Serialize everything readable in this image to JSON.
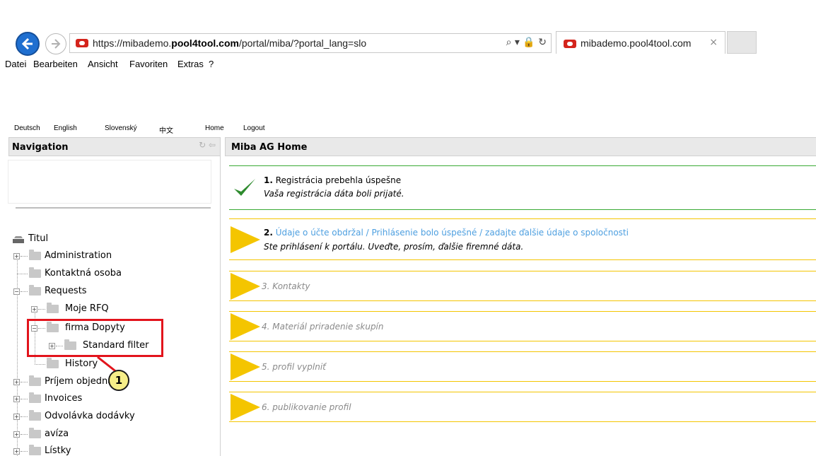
{
  "browser": {
    "url_prefix": "https://mibademo.",
    "url_domain": "pool4tool.com",
    "url_suffix": "/portal/miba/?portal_lang=slo",
    "address_tools": "⌕ ▾ 🔒 ↻",
    "tab_title": "mibademo.pool4tool.com",
    "tab_close": "×",
    "menu": [
      "Datei",
      "Bearbeiten",
      "Ansicht",
      "Favoriten",
      "Extras",
      "?"
    ]
  },
  "top_links": [
    "Deutsch",
    "English",
    "Slovenský",
    "中文",
    "Home",
    "Logout"
  ],
  "nav": {
    "title": "Navigation",
    "header_icons": "↻ ⇦",
    "root_label": "Titul",
    "nodes": [
      {
        "label": "Administration",
        "expander": "+"
      },
      {
        "label": "Kontaktná osoba",
        "expander": ""
      },
      {
        "label": "Requests",
        "expander": "−"
      },
      {
        "label": "Moje RFQ",
        "expander": "+"
      },
      {
        "label": "firma Dopyty",
        "expander": "−"
      },
      {
        "label": "Standard filter",
        "expander": "+"
      },
      {
        "label": "History",
        "expander": ""
      },
      {
        "label": "Príjem objednávky",
        "expander": "+"
      },
      {
        "label": "Invoices",
        "expander": "+"
      },
      {
        "label": "Odvolávka dodávky",
        "expander": "+"
      },
      {
        "label": "avíza",
        "expander": "+"
      },
      {
        "label": "Lístky",
        "expander": "+"
      }
    ]
  },
  "callout": {
    "number": "1"
  },
  "main": {
    "title": "Miba AG Home",
    "steps": [
      {
        "num": "1.",
        "title": "Registrácia prebehla úspešne",
        "subtitle": "Vaša registrácia dáta boli prijaté."
      },
      {
        "num": "2.",
        "title": "Údaje o účte obdržal / Prihlásenie bolo úspešné / zadajte ďalšie údaje o spoločnosti",
        "subtitle": "Ste prihlásení k portálu. Uveďte, prosím, ďalšie firemné dáta."
      },
      {
        "title": "3. Kontakty"
      },
      {
        "title": "4. Materiál priradenie skupín"
      },
      {
        "title": "5. profil vyplniť"
      },
      {
        "title": "6. publikovanie profil"
      }
    ]
  },
  "colors": {
    "step_done": "#3aaa35",
    "step_pending": "#f4c500",
    "link": "#4d9fe0",
    "highlight": "#e2141c"
  }
}
